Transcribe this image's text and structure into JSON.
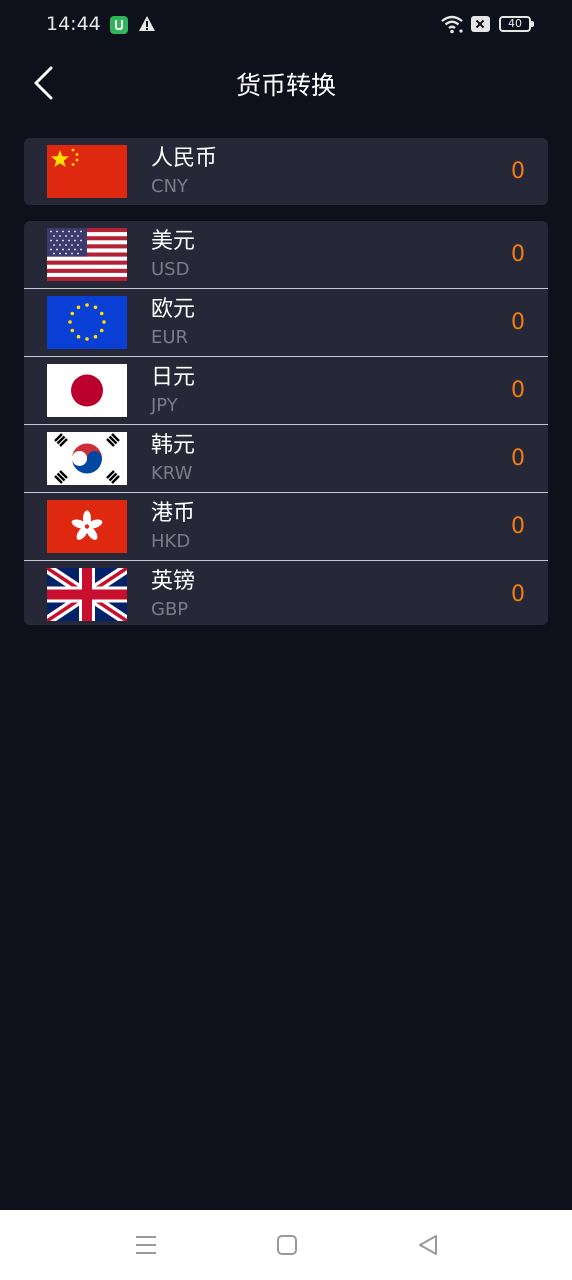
{
  "status_bar": {
    "time": "14:44",
    "battery": "40",
    "icons": [
      "app-notification-icon",
      "warning-icon",
      "wifi-icon",
      "sim-icon",
      "battery-icon"
    ]
  },
  "header": {
    "title": "货币转换",
    "back_icon": "chevron-left-icon"
  },
  "base_currency": {
    "name": "人民币",
    "code": "CNY",
    "value": "0",
    "flag": "cn-flag-icon"
  },
  "currencies": [
    {
      "name": "美元",
      "code": "USD",
      "value": "0",
      "flag": "us-flag-icon"
    },
    {
      "name": "欧元",
      "code": "EUR",
      "value": "0",
      "flag": "eu-flag-icon"
    },
    {
      "name": "日元",
      "code": "JPY",
      "value": "0",
      "flag": "jp-flag-icon"
    },
    {
      "name": "韩元",
      "code": "KRW",
      "value": "0",
      "flag": "kr-flag-icon"
    },
    {
      "name": "港币",
      "code": "HKD",
      "value": "0",
      "flag": "hk-flag-icon"
    },
    {
      "name": "英镑",
      "code": "GBP",
      "value": "0",
      "flag": "gb-flag-icon"
    }
  ],
  "nav_bar": {
    "buttons": [
      "menu-icon",
      "home-square-icon",
      "back-triangle-icon"
    ]
  },
  "colors": {
    "background": "#0e111c",
    "card": "#262837",
    "value": "#f57b13",
    "code": "#7a7c86"
  }
}
